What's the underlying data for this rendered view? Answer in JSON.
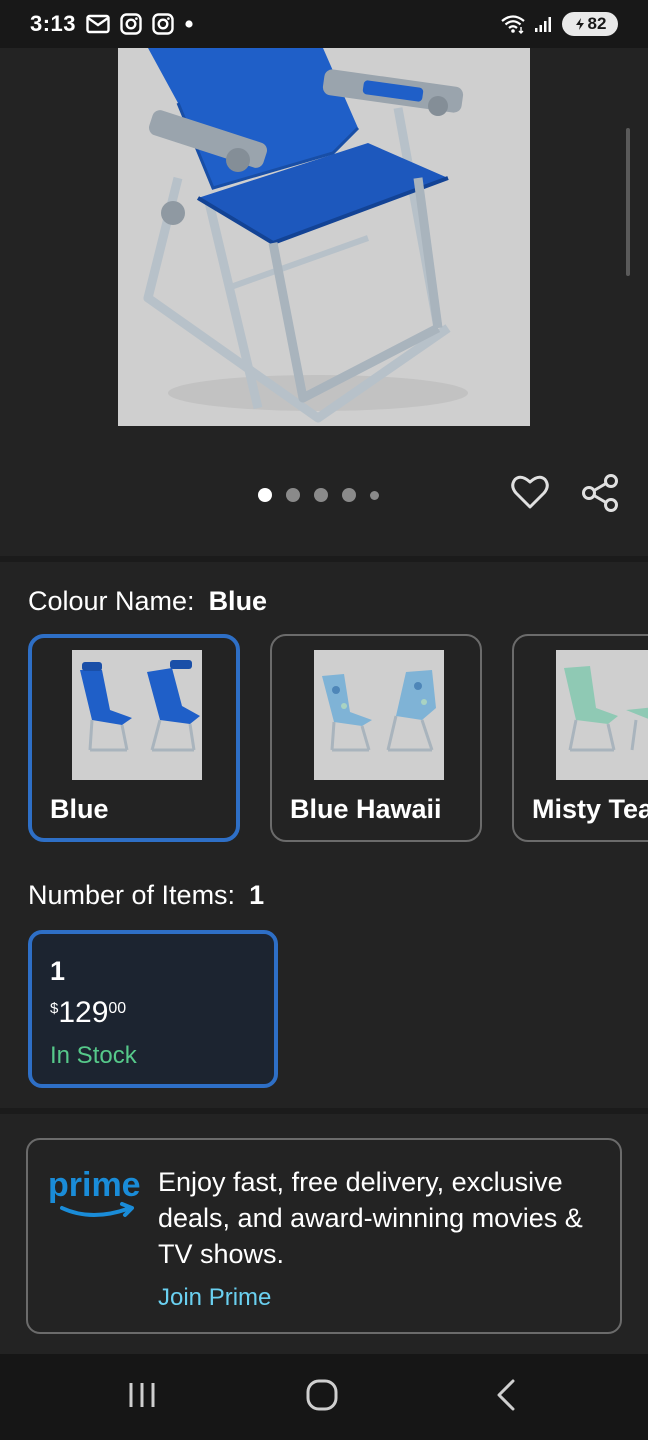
{
  "status_bar": {
    "time": "3:13",
    "battery_level": "82",
    "icons": [
      "mail-icon",
      "instagram-icon",
      "instagram-icon",
      "notification-dot-icon",
      "wifi-icon",
      "signal-icon",
      "battery-icon"
    ]
  },
  "gallery": {
    "image_subject": "blue folding beach chair with armrest cup holders",
    "dot_count": 5,
    "active_dot": 0,
    "icons": [
      "heart-icon",
      "share-icon"
    ]
  },
  "colour": {
    "label": "Colour Name:",
    "selected": "Blue",
    "options": [
      {
        "label": "Blue",
        "selected": true,
        "color": "#1f5fc8"
      },
      {
        "label": "Blue Hawaii",
        "selected": false,
        "color": "#7fb3d6"
      },
      {
        "label": "Misty Teal",
        "selected": false,
        "color": "#8fc9b4"
      }
    ]
  },
  "items": {
    "label": "Number of Items:",
    "selected": "1",
    "card": {
      "qty": "1",
      "currency": "$",
      "price_whole": "129",
      "price_cents": "00",
      "stock": "In Stock"
    }
  },
  "prime": {
    "logo_text": "prime",
    "description": "Enjoy fast, free delivery, exclusive deals, and award-winning movies & TV shows.",
    "link": "Join Prime",
    "accent": "#1a8cd8"
  },
  "nav": {
    "icons": [
      "recents-icon",
      "home-icon",
      "back-icon"
    ]
  },
  "colors": {
    "background": "#232323",
    "selected_border": "#2e6fc6",
    "in_stock": "#56c98a",
    "link": "#6ad0f0"
  }
}
